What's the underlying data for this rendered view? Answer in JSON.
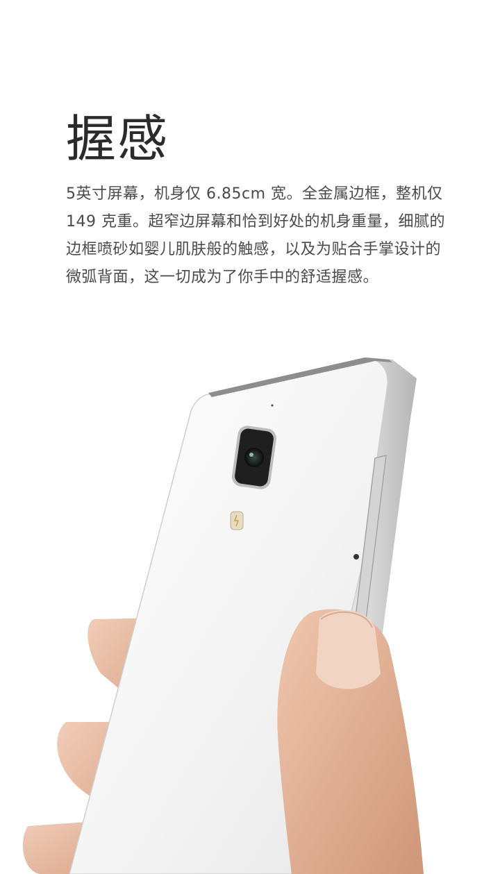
{
  "page": {
    "title": "握感",
    "description_lines": [
      "5英寸屏幕，机身仅 6.85cm 宽。全金属边框，整机仅",
      "149 克重。超窄边屏幕和恰到好处的机身重量，细腻的",
      "边框喷砂如婴儿肌肤般的触感，以及为贴合手掌设计的",
      "微弧背面，这一切成为了你手中的舒适握感。"
    ]
  },
  "colors": {
    "background": "#ffffff",
    "title": "#2b2b2b",
    "body_text": "#4a4a4a",
    "phone_back": "#f4f4f4",
    "phone_frame": "#c8c8c8",
    "skin": "#e8bca4"
  }
}
